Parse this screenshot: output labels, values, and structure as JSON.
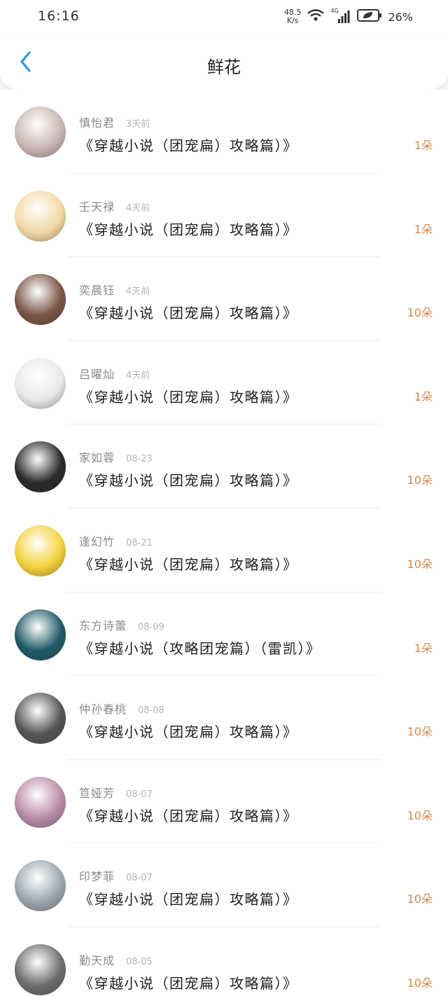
{
  "status_bar": {
    "time": "16:16",
    "net_speed_value": "48.5",
    "net_speed_unit": "K/s",
    "network_type": "4G",
    "battery_pct": "26%",
    "icons": [
      "wifi-icon",
      "signal-icon",
      "battery-icon"
    ]
  },
  "nav": {
    "back_icon": "chevron-left-icon",
    "title": "鲜花"
  },
  "colors": {
    "accent_blue": "#2f96e6",
    "count_orange": "#d4894c"
  },
  "items": [
    {
      "username": "慎怡君",
      "time": "3天前",
      "title": "《穿越小说（团宠扁）攻略篇）》",
      "count": "1朵",
      "avatar_theme": "#c9b8b3"
    },
    {
      "username": "壬天禄",
      "time": "4天前",
      "title": "《穿越小说（团宠扁）攻略篇）》",
      "count": "1朵",
      "avatar_theme": "#f2d9a6"
    },
    {
      "username": "奕晨钰",
      "time": "4天前",
      "title": "《穿越小说（团宠扁）攻略篇）》",
      "count": "10朵",
      "avatar_theme": "#7a5546"
    },
    {
      "username": "吕曜灿",
      "time": "4天前",
      "title": "《穿越小说（团宠扁）攻略篇）》",
      "count": "1朵",
      "avatar_theme": "#e9e9e9"
    },
    {
      "username": "家如蓉",
      "time": "08-23",
      "title": "《穿越小说（团宠扁）攻略篇）》",
      "count": "10朵",
      "avatar_theme": "#2a2a2a"
    },
    {
      "username": "逢幻竹",
      "time": "08-21",
      "title": "《穿越小说（团宠扁）攻略篇）》",
      "count": "10朵",
      "avatar_theme": "#f4d23c"
    },
    {
      "username": "东方诗蕾",
      "time": "08-09",
      "title": "《穿越小说（攻略团宠篇）（雷凯）》",
      "count": "1朵",
      "avatar_theme": "#1f5a66"
    },
    {
      "username": "仲孙春桃",
      "time": "08-08",
      "title": "《穿越小说（团宠扁）攻略篇）》",
      "count": "10朵",
      "avatar_theme": "#555555"
    },
    {
      "username": "笪娅芳",
      "time": "08-07",
      "title": "《穿越小说（团宠扁）攻略篇）》",
      "count": "10朵",
      "avatar_theme": "#b98aa8"
    },
    {
      "username": "印梦菲",
      "time": "08-07",
      "title": "《穿越小说（团宠扁）攻略篇）》",
      "count": "10朵",
      "avatar_theme": "#9aa7b0"
    },
    {
      "username": "勤天成",
      "time": "08-05",
      "title": "《穿越小说（团宠扁）攻略篇）》",
      "count": "10朵",
      "avatar_theme": "#6d6d6d"
    }
  ]
}
